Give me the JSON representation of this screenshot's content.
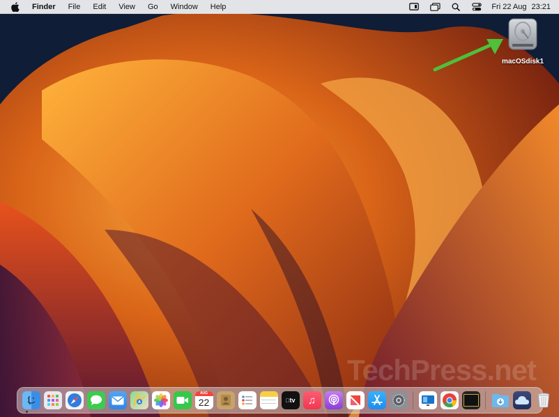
{
  "menubar": {
    "app_name": "Finder",
    "items": [
      "File",
      "Edit",
      "View",
      "Go",
      "Window",
      "Help"
    ],
    "clock_date": "Fri 22 Aug",
    "clock_time": "23:21",
    "status_icons": [
      "screen-record-icon",
      "window-stage-icon",
      "search-icon",
      "control-center-icon"
    ]
  },
  "desktop": {
    "disk_label": "macOSdisk1",
    "watermark": "TechPress.net"
  },
  "dock": {
    "calendar_month": "AUG",
    "calendar_day": "22",
    "tv_label": "tv",
    "icons": [
      "finder",
      "launchpad",
      "safari",
      "messages",
      "mail",
      "maps",
      "photos",
      "facetime",
      "calendar",
      "contacts",
      "reminders",
      "notes",
      "tv",
      "music",
      "podcasts",
      "news",
      "app-store",
      "system-settings",
      "remote-desktop",
      "chrome",
      "clock-widget",
      "downloads-folder",
      "icloud-drive",
      "trash"
    ],
    "colors": {
      "finder": "#3a8ee6",
      "safari": "#2f7de1",
      "messages": "#3ccb4f",
      "mail": "#2f86e8",
      "facetime": "#35c84a",
      "music": "#f2374f",
      "podcasts": "#9b4de0",
      "app_store": "#1c8df0",
      "chrome_red": "#e84235"
    }
  }
}
